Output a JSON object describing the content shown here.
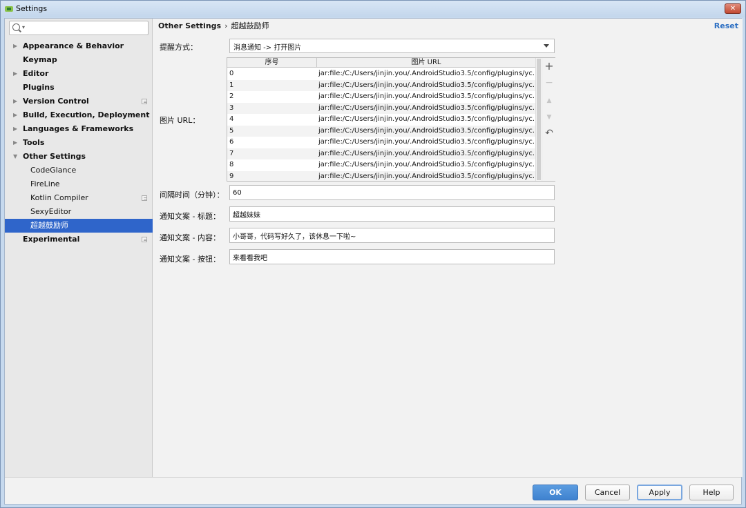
{
  "window": {
    "title": "Settings",
    "close_label": "✕"
  },
  "search": {
    "value": "",
    "placeholder": ""
  },
  "sidebar": {
    "items": [
      {
        "label": "Appearance & Behavior",
        "expandable": true,
        "expanded": false
      },
      {
        "label": "Keymap"
      },
      {
        "label": "Editor",
        "expandable": true,
        "expanded": false
      },
      {
        "label": "Plugins"
      },
      {
        "label": "Version Control",
        "expandable": true,
        "expanded": false,
        "project_icon": true
      },
      {
        "label": "Build, Execution, Deployment",
        "expandable": true,
        "expanded": false
      },
      {
        "label": "Languages & Frameworks",
        "expandable": true,
        "expanded": false
      },
      {
        "label": "Tools",
        "expandable": true,
        "expanded": false
      },
      {
        "label": "Other Settings",
        "expandable": true,
        "expanded": true
      },
      {
        "label": "CodeGlance",
        "child": true
      },
      {
        "label": "FireLine",
        "child": true
      },
      {
        "label": "Kotlin Compiler",
        "child": true,
        "project_icon": true
      },
      {
        "label": "SexyEditor",
        "child": true
      },
      {
        "label": "超越鼓励师",
        "child": true,
        "selected": true
      },
      {
        "label": "Experimental",
        "project_icon": true
      }
    ]
  },
  "breadcrumb": {
    "parent": "Other Settings",
    "separator": "›",
    "current": "超越鼓励师"
  },
  "reset_label": "Reset",
  "form": {
    "reminder_label": "提醒方式：",
    "reminder_value": "消息通知 -> 打开图片",
    "image_url_label": "图片 URL：",
    "table": {
      "headers": [
        "序号",
        "图片 URL"
      ],
      "rows": [
        [
          "0",
          "jar:file:/C:/Users/jinjin.you/.AndroidStudio3.5/config/plugins/yc..."
        ],
        [
          "1",
          "jar:file:/C:/Users/jinjin.you/.AndroidStudio3.5/config/plugins/yc..."
        ],
        [
          "2",
          "jar:file:/C:/Users/jinjin.you/.AndroidStudio3.5/config/plugins/yc..."
        ],
        [
          "3",
          "jar:file:/C:/Users/jinjin.you/.AndroidStudio3.5/config/plugins/yc..."
        ],
        [
          "4",
          "jar:file:/C:/Users/jinjin.you/.AndroidStudio3.5/config/plugins/yc..."
        ],
        [
          "5",
          "jar:file:/C:/Users/jinjin.you/.AndroidStudio3.5/config/plugins/yc..."
        ],
        [
          "6",
          "jar:file:/C:/Users/jinjin.you/.AndroidStudio3.5/config/plugins/yc..."
        ],
        [
          "7",
          "jar:file:/C:/Users/jinjin.you/.AndroidStudio3.5/config/plugins/yc..."
        ],
        [
          "8",
          "jar:file:/C:/Users/jinjin.you/.AndroidStudio3.5/config/plugins/yc..."
        ],
        [
          "9",
          "jar:file:/C:/Users/jinjin.you/.AndroidStudio3.5/config/plugins/yc..."
        ]
      ]
    },
    "tools": {
      "add": "+",
      "remove": "−",
      "up": "▲",
      "down": "▼",
      "restore": "↶"
    },
    "interval_label": "间隔时间（分钟）：",
    "interval_value": "60",
    "title_label": "通知文案 - 标题：",
    "title_value": "超越妹妹",
    "content_label": "通知文案 - 内容：",
    "content_value": "小哥哥，代码写好久了，该休息一下啦~",
    "button_label": "通知文案 - 按钮：",
    "button_value": "来看看我吧"
  },
  "buttons": {
    "ok": "OK",
    "cancel": "Cancel",
    "apply": "Apply",
    "help": "Help"
  },
  "colors": {
    "accent": "#2f65ca",
    "link": "#2c6fc2",
    "primary_button": "#4a8ed8"
  }
}
